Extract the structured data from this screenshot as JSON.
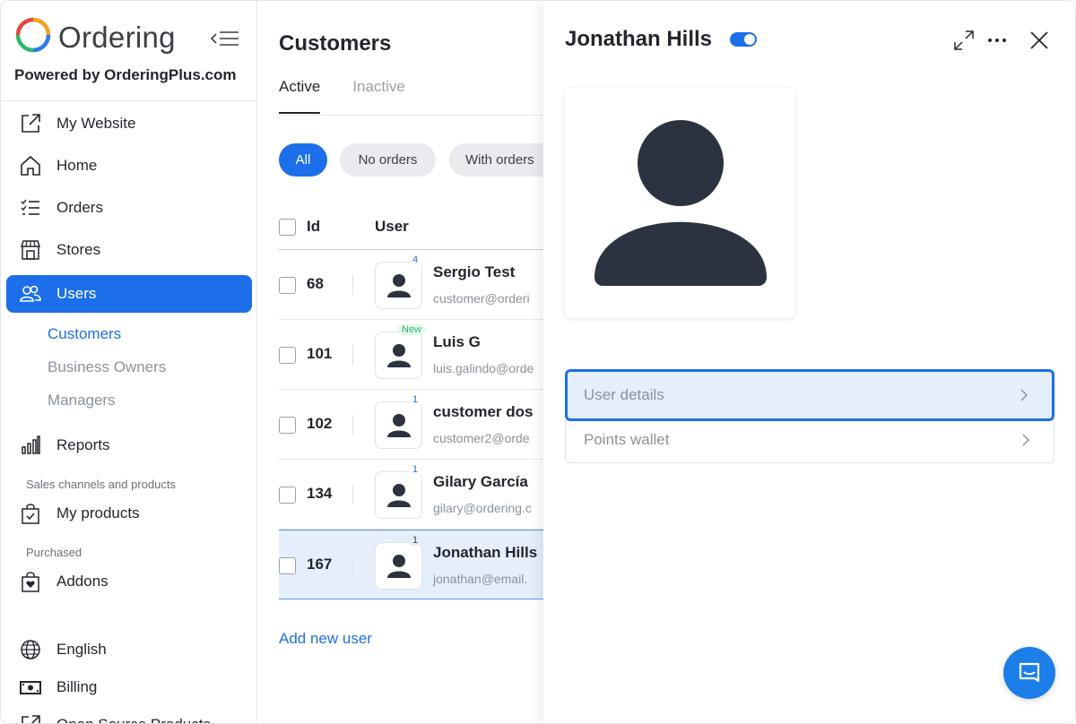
{
  "brand": {
    "name": "Ordering",
    "powered_by": "Powered by OrderingPlus.com"
  },
  "sidebar": {
    "items": [
      {
        "label": "My Website",
        "icon": "external-link-icon"
      },
      {
        "label": "Home",
        "icon": "home-icon"
      },
      {
        "label": "Orders",
        "icon": "list-icon"
      },
      {
        "label": "Stores",
        "icon": "store-icon"
      },
      {
        "label": "Users",
        "icon": "users-icon",
        "active": true
      },
      {
        "label": "Reports",
        "icon": "bar-chart-icon"
      },
      {
        "label": "My products",
        "icon": "bag-check-icon"
      },
      {
        "label": "Addons",
        "icon": "bag-heart-icon"
      },
      {
        "label": "English",
        "icon": "globe-icon"
      },
      {
        "label": "Billing",
        "icon": "cash-icon"
      },
      {
        "label": "Open Source Products",
        "icon": "external-link-icon"
      }
    ],
    "sub_items": [
      {
        "label": "Customers",
        "active": true
      },
      {
        "label": "Business Owners"
      },
      {
        "label": "Managers"
      }
    ],
    "groups": {
      "sales": "Sales channels and products",
      "purchased": "Purchased"
    }
  },
  "main": {
    "title": "Customers",
    "tabs": [
      {
        "label": "Active",
        "active": true
      },
      {
        "label": "Inactive"
      }
    ],
    "filters": [
      {
        "label": "All",
        "active": true
      },
      {
        "label": "No orders"
      },
      {
        "label": "With orders"
      }
    ],
    "columns": {
      "id": "Id",
      "user": "User"
    },
    "rows": [
      {
        "id": "68",
        "name": "Sergio Test",
        "email": "customer@orderi",
        "badge": "4"
      },
      {
        "id": "101",
        "name": "Luis G",
        "email": "luis.galindo@orde",
        "badge": "New"
      },
      {
        "id": "102",
        "name": "customer dos",
        "email": "customer2@orde",
        "badge": "1"
      },
      {
        "id": "134",
        "name": "Gilary García",
        "email": "gilary@ordering.c",
        "badge": "1"
      },
      {
        "id": "167",
        "name": "Jonathan Hills",
        "email": "jonathan@email.",
        "badge": "1",
        "selected": true
      }
    ],
    "add_user": "Add new user"
  },
  "drawer": {
    "title": "Jonathan Hills",
    "active_toggle": true,
    "menu": [
      {
        "label": "User details",
        "focused": true
      },
      {
        "label": "Points wallet"
      }
    ]
  },
  "colors": {
    "accent": "#1c6fe8",
    "selected_row": "#e5effc",
    "new_badge": "#2fb86c"
  }
}
